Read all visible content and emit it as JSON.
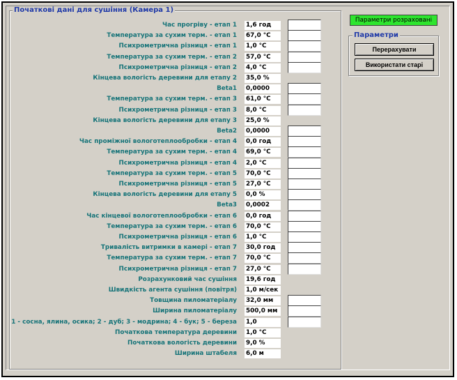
{
  "group_title": "Початкові дані для сушіння (Камера 1)",
  "params_title": "Параметри",
  "status_text": "Параметри розраховані",
  "buttons": {
    "recalc": "Перерахувати",
    "use_old": "Використати старі"
  },
  "rows": [
    {
      "label": "Час прогріву - етап 1",
      "value": "1,6 год",
      "has_input": true
    },
    {
      "label": "Температура за сухим терм. - етап 1",
      "value": "67,0 °C",
      "has_input": true
    },
    {
      "label": "Психрометрична різниця - етап 1",
      "value": "1,0 °C",
      "has_input": true
    },
    {
      "label": "Температура за сухим терм. - етап 2",
      "value": "57,0 °C",
      "has_input": true
    },
    {
      "label": "Психрометрична різниця - етап 2",
      "value": "4,0 °C",
      "has_input": true
    },
    {
      "label": "Кінцева вологість деревини для етапу 2",
      "value": "35,0 %",
      "has_input": false
    },
    {
      "label": "Beta1",
      "value": "0,0000",
      "has_input": true
    },
    {
      "label": "Температура за сухим терм. - етап 3",
      "value": "61,0 °C",
      "has_input": true
    },
    {
      "label": "Психрометрична різниця - етап 3",
      "value": "8,0 °C",
      "has_input": true
    },
    {
      "label": "Кінцева вологість деревини для етапу 3",
      "value": "25,0 %",
      "has_input": false
    },
    {
      "label": "Beta2",
      "value": "0,0000",
      "has_input": true
    },
    {
      "label": "Час проміжної вологотеплообробки - етап 4",
      "value": "0,0 год",
      "has_input": true
    },
    {
      "label": "Температура за сухим терм. - етап 4",
      "value": "69,0 °C",
      "has_input": true
    },
    {
      "label": "Психрометрична різниця - етап 4",
      "value": "2,0 °C",
      "has_input": true
    },
    {
      "label": "Температура за сухим терм. - етап 5",
      "value": "70,0 °C",
      "has_input": true
    },
    {
      "label": "Психрометрична різниця - етап 5",
      "value": "27,0 °C",
      "has_input": true
    },
    {
      "label": "Кінцева вологість деревини для етапу 5",
      "value": "0,0 %",
      "has_input": true
    },
    {
      "label": "Beta3",
      "value": "0,0002",
      "has_input": true
    },
    {
      "label": "Час кінцевої вологотеплообробки - етап 6",
      "value": "0,0 год",
      "has_input": true
    },
    {
      "label": "Температура за сухим терм. - етап 6",
      "value": "70,0 °C",
      "has_input": true
    },
    {
      "label": "Психрометрична різниця - етап 6",
      "value": "1,0 °C",
      "has_input": true
    },
    {
      "label": "Тривалість витримки в камері - етап 7",
      "value": "30,0 год",
      "has_input": true
    },
    {
      "label": "Температура за сухим терм. - етап 7",
      "value": "70,0 °C",
      "has_input": true
    },
    {
      "label": "Психрометрична різниця - етап 7",
      "value": "27,0 °C",
      "has_input": true
    },
    {
      "label": "Розрахунковий час сушіння",
      "value": "19,6 год",
      "has_input": false
    },
    {
      "label": "Швидкість агента сушіння (повітря)",
      "value": "1,0 м/сек",
      "has_input": false
    },
    {
      "label": "Товщина пиломатеріалу",
      "value": "32,0 мм",
      "has_input": true
    },
    {
      "label": "Ширина пиломатеріалу",
      "value": "500,0 мм",
      "has_input": true
    },
    {
      "label": "1 - сосна, ялина, осика; 2 - дуб; 3 - модрина; 4 - бук; 5 - береза",
      "value": "1,0",
      "has_input": true
    },
    {
      "label": "Початкова температура деревини",
      "value": "1,0 °C",
      "has_input": false
    },
    {
      "label": "Початкова вологість деревини",
      "value": "9,0 %",
      "has_input": false
    },
    {
      "label": "Ширина штабеля",
      "value": "6,0 м",
      "has_input": false
    }
  ]
}
